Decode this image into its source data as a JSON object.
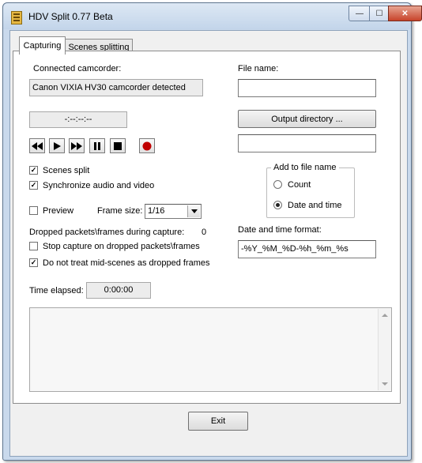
{
  "window": {
    "title": "HDV Split 0.77 Beta",
    "min_glyph": "—",
    "max_glyph": "☐",
    "close_glyph": "✕"
  },
  "tabs": [
    {
      "label": "Capturing",
      "active": true
    },
    {
      "label": "Scenes splitting",
      "active": false
    }
  ],
  "capture": {
    "connected_label": "Connected camcorder:",
    "camcorder_status": "Canon VIXIA HV30 camcorder detected",
    "timecode": "-:--:--:--"
  },
  "transport": {
    "icons": [
      "rewind-icon",
      "play-icon",
      "fast-forward-icon",
      "pause-icon",
      "stop-icon",
      "record-icon"
    ],
    "record_color": "#c00000"
  },
  "options": {
    "scenes_split": {
      "label": "Scenes split",
      "checked": true
    },
    "sync_av": {
      "label": "Synchronize audio and video",
      "checked": true
    },
    "preview": {
      "label": "Preview",
      "checked": false
    },
    "frame_size_label": "Frame size:",
    "frame_size_value": "1/16",
    "dropped_label": "Dropped packets\\frames during capture:",
    "dropped_count": "0",
    "stop_on_dropped": {
      "label": "Stop capture on dropped packets\\frames",
      "checked": false
    },
    "no_mid_scenes": {
      "label": "Do not treat mid-scenes as dropped frames",
      "checked": true
    }
  },
  "elapsed": {
    "label": "Time elapsed:",
    "value": "0:00:00"
  },
  "file": {
    "name_label": "File name:",
    "name_value": "",
    "output_button": "Output directory ...",
    "output_value": "",
    "add_group_title": "Add to file name",
    "radio_count": {
      "label": "Count",
      "checked": false
    },
    "radio_datetime": {
      "label": "Date and time",
      "checked": true
    },
    "datetime_format_label": "Date and time format:",
    "datetime_format_value": "-%Y_%M_%D-%h_%m_%s"
  },
  "log": {
    "text": ""
  },
  "exit_label": "Exit"
}
